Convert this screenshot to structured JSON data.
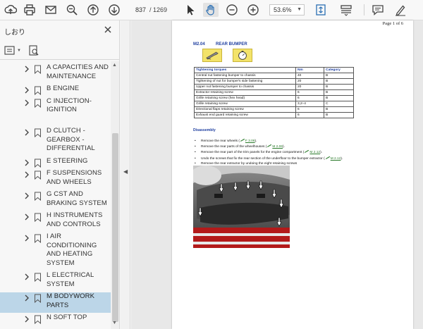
{
  "toolbar": {
    "page_current": "837",
    "page_total": "/ 1269",
    "zoom": "53.6%",
    "icons": [
      "upload-icon",
      "print-icon",
      "mail-icon",
      "zoom-out-search-icon",
      "page-up-icon",
      "page-down-icon",
      "select-cursor-icon",
      "hand-icon",
      "zoom-out-icon",
      "zoom-in-icon",
      "fit-page-icon",
      "scroll-mode-icon",
      "comment-icon",
      "sign-icon"
    ]
  },
  "panel": {
    "title": "しおり",
    "bookmarks": [
      {
        "label": "A CAPACITIES AND MAINTENANCE"
      },
      {
        "label": "B ENGINE"
      },
      {
        "label": "C INJECTION-IGNITION"
      },
      {
        "label": "D CLUTCH - GEARBOX - DIFFERENTIAL"
      },
      {
        "label": "E STEERING"
      },
      {
        "label": "F SUSPENSIONS AND WHEELS"
      },
      {
        "label": "G CST AND BRAKING SYSTEM"
      },
      {
        "label": "H INSTRUMENTS AND CONTROLS"
      },
      {
        "label": "I AIR CONDITIONING AND HEATING SYSTEM"
      },
      {
        "label": "L ELECTRICAL SYSTEM"
      },
      {
        "label": "M BODYWORK PARTS"
      },
      {
        "label": "N SOFT TOP"
      }
    ],
    "selected_index": 10
  },
  "document": {
    "page_label": "Page 1 of 6",
    "section_code": "M2.04",
    "section_title": "REAR BUMPER",
    "table_header": [
      "Tightening torques",
      "Nm",
      "Category"
    ],
    "table_rows": [
      [
        "Central nut fastening bumper to chassis",
        "40",
        "B"
      ],
      [
        "Tightening of nut for bumper's side fastening",
        "20",
        "B"
      ],
      [
        "Upper nut fastening bumper to chassis",
        "20",
        "B"
      ],
      [
        "Extractor retaining screw",
        "6",
        "B"
      ],
      [
        "Grille retaining screw (hex head)",
        "6",
        "B"
      ],
      [
        "Grille retaining screw",
        "3,2÷4",
        "C"
      ],
      [
        "Directional flaps retaining screw",
        "6",
        "B"
      ],
      [
        "Exhaust end guard retaining screw",
        "6",
        "B"
      ]
    ],
    "disassembly_title": "Disassembly",
    "steps": [
      {
        "text": "Remove the rear wheels (",
        "ref": "F 3.06",
        "end": ")."
      },
      {
        "text": "Remove the rear parts of the wheelhouses (",
        "ref": "M 2.06",
        "end": ")."
      },
      {
        "text": "Remove the rear part of the trim panels for the engine compartment (",
        "ref": "M 2.12",
        "end": ")."
      },
      {
        "text": "Undo the screws that fix the rear section of the underfloor to the bumper extractor (",
        "ref": "M 2.12",
        "end": ")."
      },
      {
        "text": "Remove the rear extractor by undoing the eight retaining screws",
        "ref": "",
        "end": ""
      }
    ]
  },
  "colors": {
    "heading_blue": "#1f3fa0",
    "link_green": "#2a7a2a",
    "selection": "#bcd6e8",
    "icon_yellow": "#f3e36a"
  }
}
